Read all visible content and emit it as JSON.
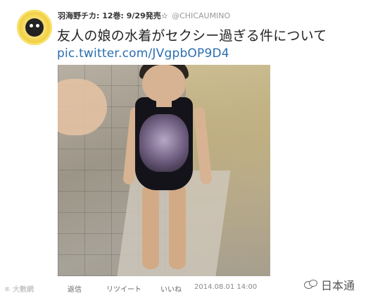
{
  "tweet": {
    "display_name": "羽海野チカ: 12巻: 9/29発売☆",
    "handle": "@CHICAUMINO",
    "text": "友人の娘の水着がセクシー過ぎる件について",
    "link": "pic.twitter.com/JVgpbOP9D4",
    "avatar_icon": "avatar-icon",
    "photo_icon": "photo-icon"
  },
  "actions": {
    "reply": "返信",
    "retweet": "リツイート",
    "like": "いいね",
    "timestamp": "2014.08.01 14:00"
  },
  "watermark": {
    "left": "⑥ 大數網",
    "right": "日本通",
    "right_icon": "wechat-icon"
  },
  "colors": {
    "link": "#2a6fb0",
    "text": "#222222",
    "muted": "#999999"
  }
}
